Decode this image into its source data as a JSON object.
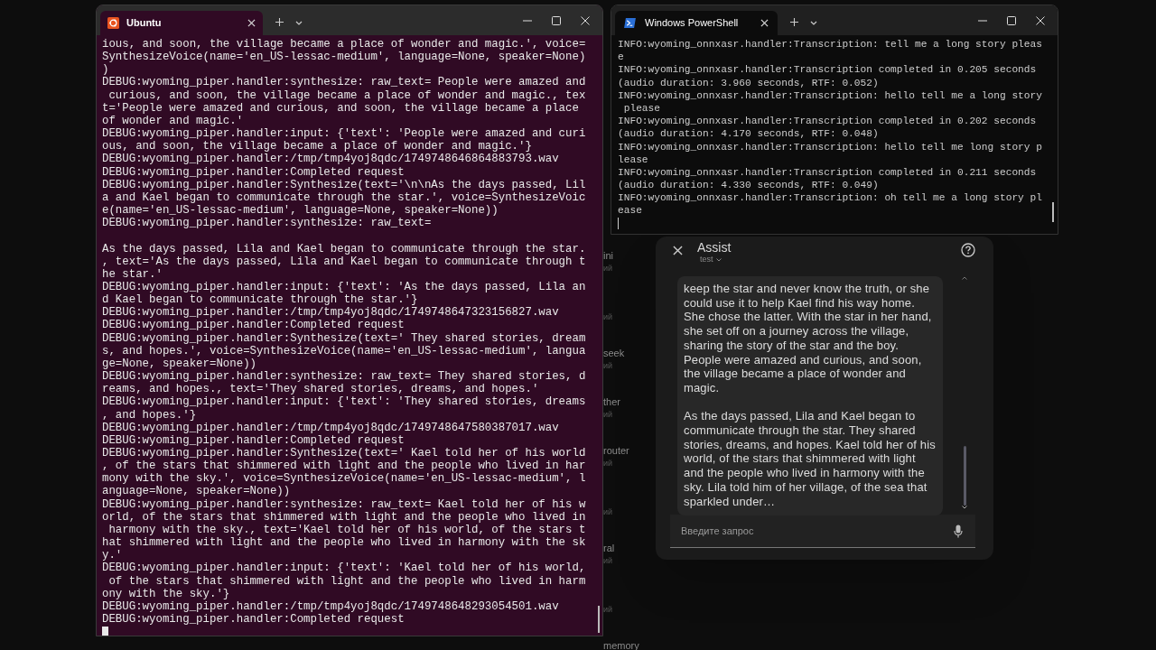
{
  "background_list": [
    {
      "label": "ini",
      "sub": "ий"
    },
    {
      "sub": "ий"
    },
    {
      "label": "seek",
      "sub": "ий"
    },
    {
      "label": "ther",
      "sub": "ий"
    },
    {
      "label": "router",
      "sub": "ий"
    },
    {
      "sub": "ий"
    },
    {
      "label": "ral",
      "sub": "ий"
    },
    {
      "sub": "ий"
    },
    {
      "label": "memory"
    }
  ],
  "ubuntu_window": {
    "tab_title": "Ubuntu",
    "lines": [
      {
        "text": "ious, and soon, the village became a place of wonder and magic.', voice="
      },
      {
        "text": "SynthesizeVoice(name='en_US-lessac-medium', language=None, speaker=None)"
      },
      {
        "text": ")"
      },
      {
        "text": "DEBUG:wyoming_piper.handler:synthesize: raw_text= People were amazed and"
      },
      {
        "text": " curious, and soon, the village became a place of wonder and magic., tex"
      },
      {
        "text": "t='People were amazed and curious, and soon, the village became a place"
      },
      {
        "text": "of wonder and magic.'"
      },
      {
        "text": "DEBUG:wyoming_piper.handler:input: {'text': 'People were amazed and curi"
      },
      {
        "text": "ous, and soon, the village became a place of wonder and magic.'}"
      },
      {
        "text": "DEBUG:wyoming_piper.handler:/tmp/tmp4yoj8qdc/1749748646864883793.wav"
      },
      {
        "text": "DEBUG:wyoming_piper.handler:Completed request"
      },
      {
        "text": "DEBUG:wyoming_piper.handler:Synthesize(text='\\n\\nAs the days passed, Lil"
      },
      {
        "text": "a and Kael began to communicate through the star.', voice=SynthesizeVoic"
      },
      {
        "text": "e(name='en_US-lessac-medium', language=None, speaker=None))"
      },
      {
        "text": "DEBUG:wyoming_piper.handler:synthesize: raw_text="
      },
      {
        "text": "As the days passed, Lila and Kael began to communicate through the star.",
        "blank_before": true
      },
      {
        "text": ", text='As the days passed, Lila and Kael began to communicate through t"
      },
      {
        "text": "he star.'"
      },
      {
        "text": "DEBUG:wyoming_piper.handler:input: {'text': 'As the days passed, Lila an"
      },
      {
        "text": "d Kael began to communicate through the star.'}"
      },
      {
        "text": "DEBUG:wyoming_piper.handler:/tmp/tmp4yoj8qdc/1749748647323156827.wav"
      },
      {
        "text": "DEBUG:wyoming_piper.handler:Completed request"
      },
      {
        "text": "DEBUG:wyoming_piper.handler:Synthesize(text=' They shared stories, dream"
      },
      {
        "text": "s, and hopes.', voice=SynthesizeVoice(name='en_US-lessac-medium', langua"
      },
      {
        "text": "ge=None, speaker=None))"
      },
      {
        "text": "DEBUG:wyoming_piper.handler:synthesize: raw_text= They shared stories, d"
      },
      {
        "text": "reams, and hopes., text='They shared stories, dreams, and hopes.'"
      },
      {
        "text": "DEBUG:wyoming_piper.handler:input: {'text': 'They shared stories, dreams"
      },
      {
        "text": ", and hopes.'}"
      },
      {
        "text": "DEBUG:wyoming_piper.handler:/tmp/tmp4yoj8qdc/1749748647580387017.wav"
      },
      {
        "text": "DEBUG:wyoming_piper.handler:Completed request"
      },
      {
        "text": "DEBUG:wyoming_piper.handler:Synthesize(text=' Kael told her of his world"
      },
      {
        "text": ", of the stars that shimmered with light and the people who lived in har"
      },
      {
        "text": "mony with the sky.', voice=SynthesizeVoice(name='en_US-lessac-medium', l"
      },
      {
        "text": "anguage=None, speaker=None))"
      },
      {
        "text": "DEBUG:wyoming_piper.handler:synthesize: raw_text= Kael told her of his w"
      },
      {
        "text": "orld, of the stars that shimmered with light and the people who lived in"
      },
      {
        "text": " harmony with the sky., text='Kael told her of his world, of the stars t"
      },
      {
        "text": "hat shimmered with light and the people who lived in harmony with the sk"
      },
      {
        "text": "y.'"
      },
      {
        "text": "DEBUG:wyoming_piper.handler:input: {'text': 'Kael told her of his world,"
      },
      {
        "text": " of the stars that shimmered with light and the people who lived in harm"
      },
      {
        "text": "ony with the sky.'}"
      },
      {
        "text": "DEBUG:wyoming_piper.handler:/tmp/tmp4yoj8qdc/1749748648293054501.wav"
      },
      {
        "text": "DEBUG:wyoming_piper.handler:Completed request"
      }
    ]
  },
  "powershell_window": {
    "tab_title": "Windows PowerShell",
    "lines": [
      {
        "text": "INFO:wyoming_onnxasr.handler:Transcription: tell me a long story pleas"
      },
      {
        "text": "e"
      },
      {
        "text": "INFO:wyoming_onnxasr.handler:Transcription completed in 0.205 seconds"
      },
      {
        "text": "(audio duration: 3.960 seconds, RTF: 0.052)"
      },
      {
        "text": "INFO:wyoming_onnxasr.handler:Transcription: hello tell me a long story"
      },
      {
        "text": " please"
      },
      {
        "text": "INFO:wyoming_onnxasr.handler:Transcription completed in 0.202 seconds"
      },
      {
        "text": "(audio duration: 4.170 seconds, RTF: 0.048)"
      },
      {
        "text": "INFO:wyoming_onnxasr.handler:Transcription: hello tell me long story p"
      },
      {
        "text": "lease"
      },
      {
        "text": "INFO:wyoming_onnxasr.handler:Transcription completed in 0.211 seconds"
      },
      {
        "text": "(audio duration: 4.330 seconds, RTF: 0.049)"
      },
      {
        "text": "INFO:wyoming_onnxasr.handler:Transcription: oh tell me a long story pl"
      },
      {
        "text": "ease"
      }
    ]
  },
  "assist": {
    "title": "Assist",
    "pipeline": "test",
    "message_paragraphs": [
      "keep the star and never know the truth, or she could use it to help Kael find his way home. She chose the latter. With the star in her hand, she set off on a journey across the village, sharing the story of the star and the boy. People were amazed and curious, and soon, the village became a place of wonder and magic.",
      "As the days passed, Lila and Kael began to communicate through the star. They shared stories, dreams, and hopes. Kael told her of his world, of the stars that shimmered with light and the people who lived in harmony with the sky. Lila told him of her village, of the sea that sparkled under…"
    ],
    "input_placeholder": "Введите запрос"
  }
}
